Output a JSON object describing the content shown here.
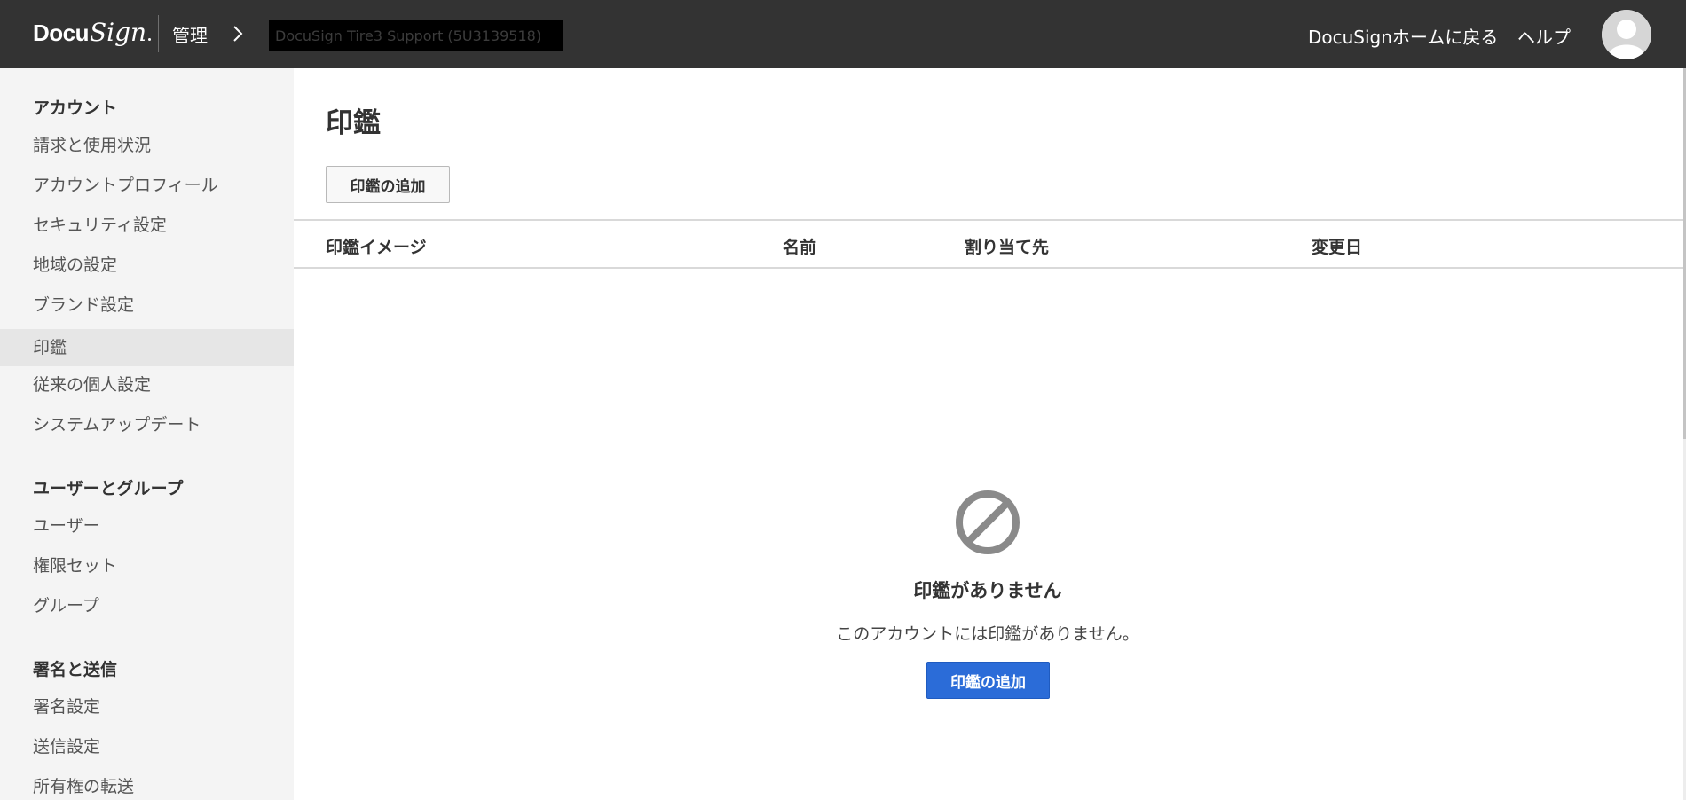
{
  "header": {
    "logo_docu": "Docu",
    "logo_sign": "Sign",
    "admin_label": "管理",
    "account_name": "DocuSign Tire3 Support (5U3139518)",
    "home_link": "DocuSignホームに戻る",
    "help_link": "ヘルプ",
    "icons": [
      "chevron-right-icon",
      "avatar-icon"
    ]
  },
  "sidebar": {
    "sections": [
      {
        "heading": "アカウント",
        "items": [
          {
            "label": "請求と使用状況"
          },
          {
            "label": "アカウントプロフィール"
          },
          {
            "label": "セキュリティ設定"
          },
          {
            "label": "地域の設定"
          },
          {
            "label": "ブランド設定"
          },
          {
            "label": "印鑑"
          },
          {
            "label": "従来の個人設定"
          },
          {
            "label": "システムアップデート"
          }
        ]
      },
      {
        "heading": "ユーザーとグループ",
        "items": [
          {
            "label": "ユーザー"
          },
          {
            "label": "権限セット"
          },
          {
            "label": "グループ"
          }
        ]
      },
      {
        "heading": "署名と送信",
        "items": [
          {
            "label": "署名設定"
          },
          {
            "label": "送信設定"
          },
          {
            "label": "所有権の転送"
          }
        ]
      }
    ],
    "active_item": "印鑑"
  },
  "main": {
    "title": "印鑑",
    "add_button": "印鑑の追加",
    "table": {
      "columns": [
        "印鑑イメージ",
        "名前",
        "割り当て先",
        "変更日"
      ]
    },
    "empty_state": {
      "icon": "no-entry-icon",
      "title": "印鑑がありません",
      "description": "このアカウントには印鑑がありません。",
      "button": "印鑑の追加"
    }
  },
  "colors": {
    "header_bg": "#333333",
    "sidebar_bg": "#f4f4f4",
    "sidebar_active_bg": "#e6e6e6",
    "primary_button": "#2b6cd8",
    "empty_icon": "#8a8a8a"
  }
}
